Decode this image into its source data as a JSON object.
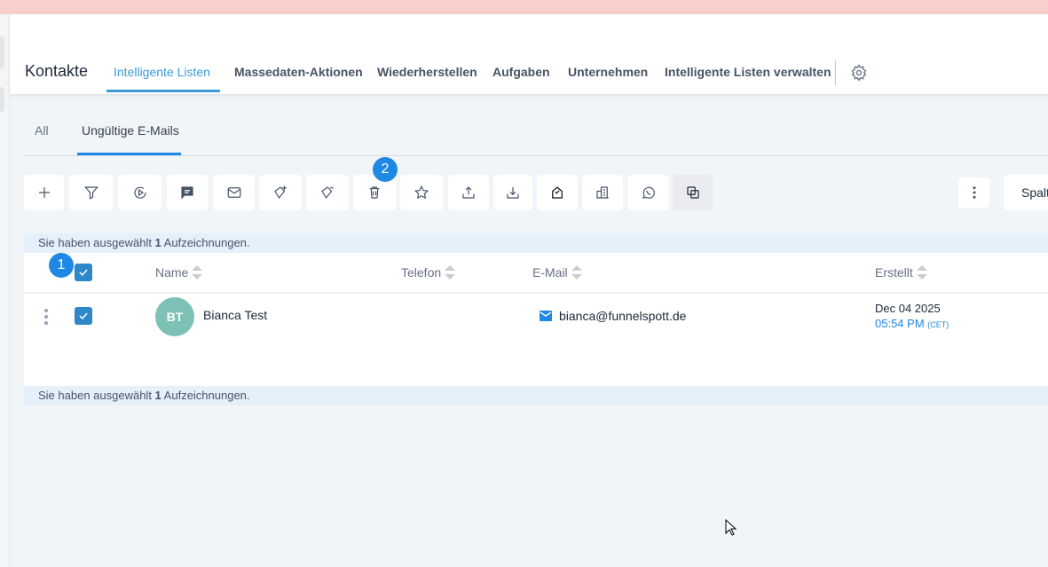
{
  "header": {
    "title": "Kontakte",
    "nav": [
      "Intelligente Listen",
      "Massedaten-Aktionen",
      "Wiederherstellen",
      "Aufgaben",
      "Unternehmen",
      "Intelligente Listen verwalten"
    ],
    "active_nav": "Intelligente Listen"
  },
  "subtabs": [
    "All",
    "Ungültige E-Mails"
  ],
  "active_subtab": "Ungültige E-Mails",
  "toolbar": {
    "icons": [
      "plus-icon",
      "filter-icon",
      "workflow-icon",
      "sms-icon",
      "email-icon",
      "add-tag-icon",
      "remove-tag-icon",
      "trash-icon",
      "star-icon",
      "export-icon",
      "import-icon",
      "review-icon",
      "company-icon",
      "whatsapp-icon",
      "merge-icon"
    ],
    "more": "more-icon",
    "columns_label": "Spalt"
  },
  "badges": {
    "one": "1",
    "two": "2"
  },
  "selection": {
    "prefix": "Sie haben ausgewählt ",
    "count": "1",
    "suffix": " Aufzeichnungen."
  },
  "table": {
    "columns": [
      "Name",
      "Telefon",
      "E-Mail",
      "Erstellt"
    ],
    "rows": [
      {
        "initials": "BT",
        "name": "Bianca Test",
        "phone": "",
        "email": "bianca@funnelspott.de",
        "date": "Dec 04 2025",
        "time": "05:54 PM",
        "tz": "(CET)",
        "selected": true
      }
    ]
  },
  "colors": {
    "accent": "#3b9bd9",
    "badge": "#1e88e5",
    "checkbox": "#2d87c8",
    "avatar": "#7dc0b6",
    "banner": "#f9cfcc"
  }
}
